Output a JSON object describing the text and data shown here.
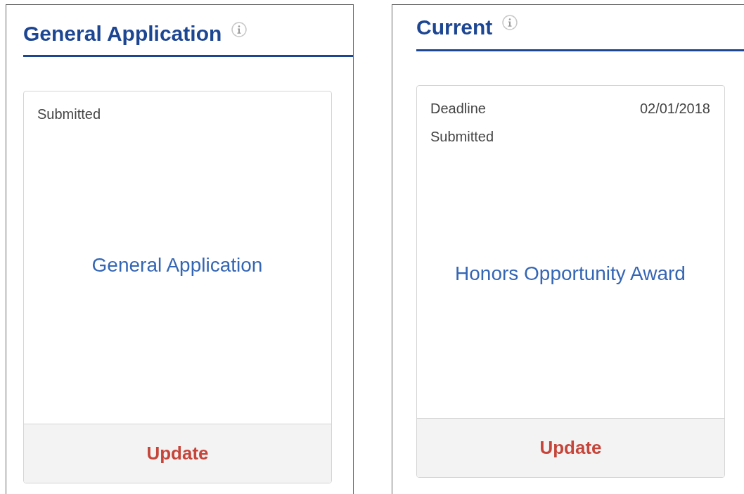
{
  "panels": [
    {
      "title": "General Application",
      "cards": [
        {
          "details": [
            {
              "label": "Submitted"
            }
          ],
          "title": "General Application",
          "action": "Update"
        }
      ]
    },
    {
      "title": "Current",
      "cards": [
        {
          "details": [
            {
              "label": "Deadline",
              "value": "02/01/2018"
            },
            {
              "label": "Submitted"
            }
          ],
          "title": "Honors Opportunity Award",
          "action": "Update"
        }
      ]
    }
  ]
}
